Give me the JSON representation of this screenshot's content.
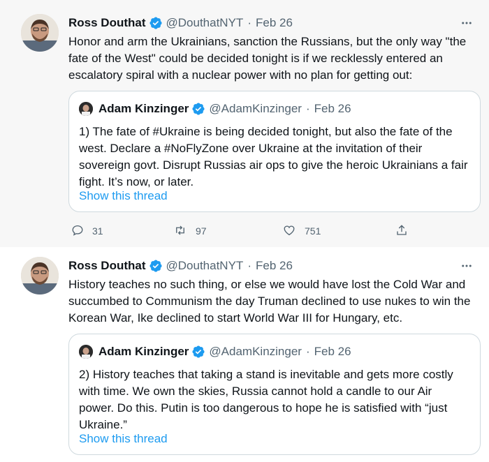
{
  "tweets": [
    {
      "author_name": "Ross Douthat",
      "handle": "@DouthatNYT",
      "separator": "·",
      "date": "Feb 26",
      "text": "Honor and arm the Ukrainians, sanction the Russians, but the only way \"the fate of the West\" could be decided tonight is if we recklessly entered an escalatory spiral with a nuclear power with no plan for getting out:",
      "quote": {
        "author_name": "Adam Kinzinger",
        "handle": "@AdamKinzinger",
        "separator": "·",
        "date": "Feb 26",
        "text": "1) The fate of #Ukraine is being decided tonight, but also the fate of the west. Declare a #NoFlyZone over Ukraine at the invitation of their sovereign govt. Disrupt Russias air ops to give the heroic Ukrainians a fair fight.  It’s now, or later.",
        "show_thread": "Show this thread"
      },
      "actions": {
        "replies": "31",
        "retweets": "97",
        "likes": "751"
      }
    },
    {
      "author_name": "Ross Douthat",
      "handle": "@DouthatNYT",
      "separator": "·",
      "date": "Feb 26",
      "text": "History teaches no such thing, or else we would have lost the Cold War and succumbed to Communism the day Truman declined to use nukes to win the Korean War, Ike declined to start World War III for Hungary, etc.",
      "quote": {
        "author_name": "Adam Kinzinger",
        "handle": "@AdamKinzinger",
        "separator": "·",
        "date": "Feb 26",
        "text": "2) History teaches that taking a stand is inevitable and gets more costly with time.  We own the skies, Russia cannot hold a candle to our Air power.  Do this.  Putin is too dangerous to hope he is satisfied with “just Ukraine.”",
        "show_thread": "Show this thread"
      }
    }
  ],
  "colors": {
    "accent": "#1d9bf0",
    "verified": "#1d9bf0",
    "muted": "#536471",
    "thread_line": "#cfd9de"
  },
  "icons": [
    "verified-badge-icon",
    "more-icon",
    "reply-icon",
    "retweet-icon",
    "like-icon",
    "share-icon"
  ]
}
